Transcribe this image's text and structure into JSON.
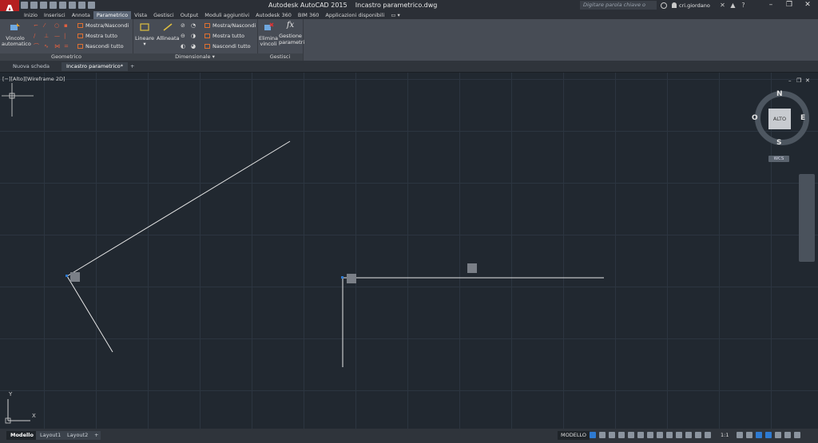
{
  "app": {
    "logo": "A",
    "title": "Autodesk AutoCAD 2015",
    "document": "Incastro parametrico.dwg",
    "search_placeholder": "Digitare parola chiave o frase",
    "user": "cri.giordano",
    "window_controls": [
      "–",
      "❐",
      "✕"
    ]
  },
  "ribbon_tabs": [
    {
      "label": "Inizio"
    },
    {
      "label": "Inserisci"
    },
    {
      "label": "Annota"
    },
    {
      "label": "Parametrico",
      "active": true
    },
    {
      "label": "Vista"
    },
    {
      "label": "Gestisci"
    },
    {
      "label": "Output"
    },
    {
      "label": "Moduli aggiuntivi"
    },
    {
      "label": "Autodesk 360"
    },
    {
      "label": "BIM 360"
    },
    {
      "label": "Applicazioni disponibili"
    }
  ],
  "ribbon": {
    "geometrico": {
      "title": "Geometrico",
      "auto_constraint": "Vincolo automatico",
      "show_hide": "Mostra/Nascondi",
      "show_all": "Mostra tutto",
      "hide_all": "Nascondi tutto"
    },
    "dimensionale": {
      "title": "Dimensionale",
      "linear": "Lineare",
      "aligned": "Allineata",
      "show_hide": "Mostra/Nascondi",
      "show_all": "Mostra tutto",
      "hide_all": "Nascondi tutto"
    },
    "gestisci": {
      "title": "Gestisci",
      "delete_constraints": "Elimina vincoli",
      "param_manager": "Gestione parametri",
      "fx": "fx"
    }
  },
  "doc_tabs": [
    {
      "label": "Nuova scheda"
    },
    {
      "label": "Incastro parametrico*",
      "active": true
    },
    {
      "label": "+"
    }
  ],
  "viewport": {
    "label": "[−][Alto][Wireframe 2D]",
    "controls": [
      "–",
      "❐",
      "✕"
    ]
  },
  "viewcube": {
    "face": "ALTO",
    "north": "N",
    "south": "S",
    "east": "E",
    "west": "O",
    "wcs": "WCS"
  },
  "ucs": {
    "x": "X",
    "y": "Y"
  },
  "layout_tabs": [
    {
      "label": "Modello",
      "active": true
    },
    {
      "label": "Layout1"
    },
    {
      "label": "Layout2"
    },
    {
      "label": "+"
    }
  ],
  "status": {
    "model": "MODELLO",
    "scale": "1:1"
  },
  "colors": {
    "background": "#212830",
    "ribbon": "#474c55",
    "line": "#e8e8e8",
    "accent": "#2e7ad1",
    "logo": "#b51f20"
  }
}
